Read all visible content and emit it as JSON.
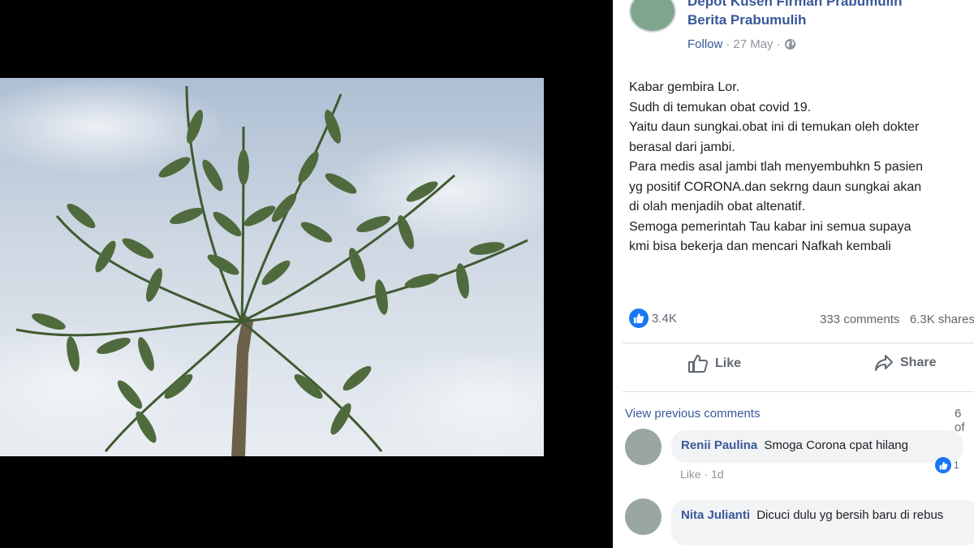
{
  "post": {
    "page_name_line1": "Depot Kusen Firman Prabumulih",
    "page_name_line2": "Berita Prabumulih",
    "follow_label": "Follow",
    "dot": "·",
    "date": "27 May",
    "privacy_icon": "globe-icon",
    "text_lines": [
      "Kabar gembira Lor.",
      "Sudh di temukan obat covid 19.",
      "Yaitu daun sungkai.obat ini di temukan oleh dokter",
      "berasal dari jambi.",
      "Para medis asal jambi tlah menyembuhkn 5 pasien",
      "yg positif CORONA.dan sekrng daun sungkai akan",
      "di olah menjadih obat altenatif.",
      "Semoga pemerintah Tau kabar ini semua supaya",
      "kmi bisa bekerja dan mencari Nafkah kembali"
    ],
    "reaction_count": "3.4K",
    "comments_count": "333 comments",
    "shares_count": "6.3K shares",
    "like_label": "Like",
    "share_label": "Share"
  },
  "comments": {
    "view_previous_label": "View previous comments",
    "count_partial": "6 of",
    "items": [
      {
        "name": "Renii Paulina",
        "text": "Smoga Corona cpat hilang",
        "like_label": "Like",
        "time": "1d",
        "reactions": "1"
      },
      {
        "name": "Nita Julianti",
        "text": "Dicuci dulu yg bersih baru di rebus"
      }
    ]
  },
  "colors": {
    "link_blue": "#385898",
    "like_blue": "#1877f2",
    "text_gray": "#606770",
    "bubble_gray": "#f2f3f5"
  }
}
